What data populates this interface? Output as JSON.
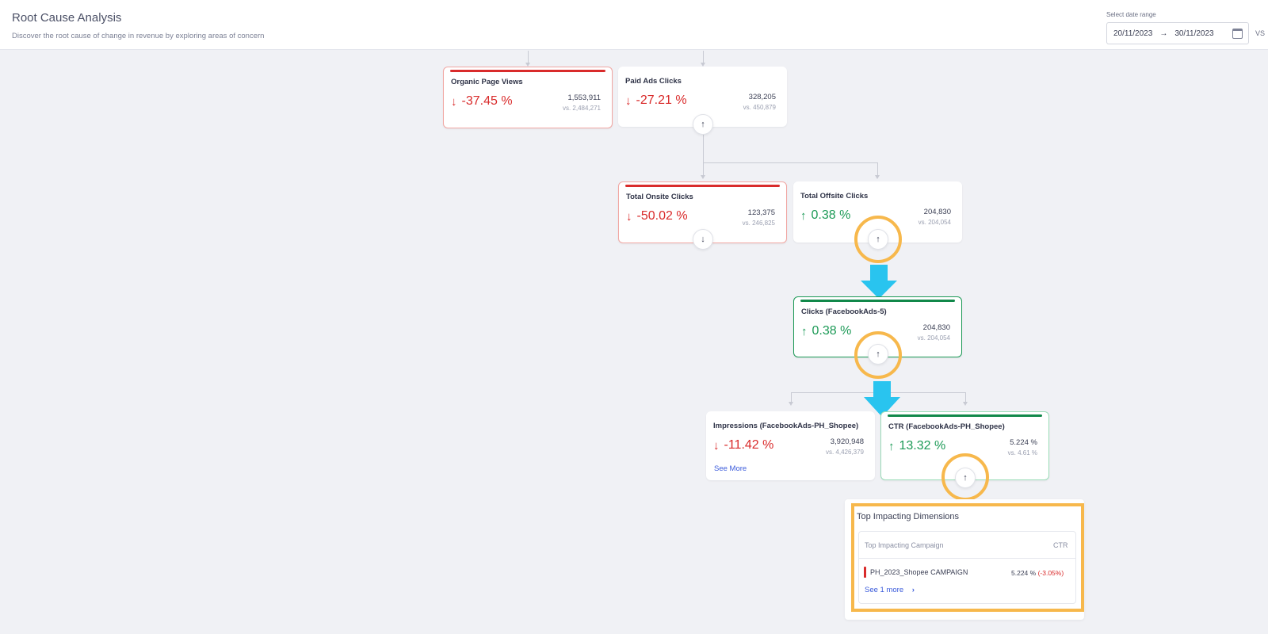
{
  "header": {
    "title": "Root Cause Analysis",
    "subtitle": "Discover the root cause of change in revenue by exploring areas of concern",
    "date_label": "Select date range",
    "date_from": "20/11/2023",
    "date_arrow": "→",
    "date_to": "30/11/2023",
    "vs": "VS"
  },
  "colors": {
    "negative": "#d92b2b",
    "positive": "#1d9a57",
    "highlight": "#f7b84c",
    "flow_arrow": "#29c4ef",
    "link": "#3b5bdb"
  },
  "nodes": {
    "organic_page_views": {
      "title": "Organic Page Views",
      "arrow": "↓",
      "change": "-37.45 %",
      "value": "1,553,911",
      "compare": "vs. 2,484,271"
    },
    "paid_ads_clicks": {
      "title": "Paid Ads Clicks",
      "arrow": "↓",
      "change": "-27.21 %",
      "value": "328,205",
      "compare": "vs. 450,879",
      "toggle": "↑"
    },
    "total_onsite_clicks": {
      "title": "Total Onsite Clicks",
      "arrow": "↓",
      "change": "-50.02 %",
      "value": "123,375",
      "compare": "vs. 246,825",
      "toggle": "↓"
    },
    "total_offsite_clicks": {
      "title": "Total Offsite Clicks",
      "arrow": "↑",
      "change": "0.38 %",
      "value": "204,830",
      "compare": "vs. 204,054",
      "toggle": "↑"
    },
    "clicks_facebookads": {
      "title": "Clicks (FacebookAds-5)",
      "arrow": "↑",
      "change": "0.38 %",
      "value": "204,830",
      "compare": "vs. 204,054",
      "toggle": "↑"
    },
    "impressions": {
      "title": "Impressions (FacebookAds-PH_Shopee)",
      "arrow": "↓",
      "change": "-11.42 %",
      "value": "3,920,948",
      "compare": "vs. 4,426,379",
      "see_more": "See More"
    },
    "ctr": {
      "title": "CTR (FacebookAds-PH_Shopee)",
      "arrow": "↑",
      "change": "13.32 %",
      "value": "5.224 %",
      "compare": "vs. 4.61 %",
      "toggle": "↑"
    }
  },
  "dimensions": {
    "title": "Top Impacting Dimensions",
    "column_left": "Top Impacting Campaign",
    "column_right": "CTR",
    "rows": [
      {
        "name": "PH_2023_Shopee CAMPAIGN",
        "value": "5.224 %",
        "change": "(-3.05%)"
      }
    ],
    "see_more": "See 1 more",
    "see_more_chevron": "›"
  }
}
